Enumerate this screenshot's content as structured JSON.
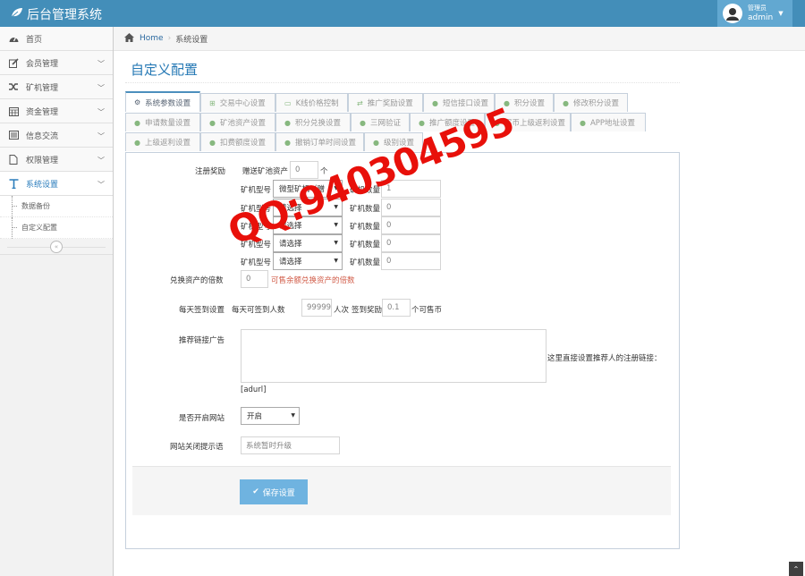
{
  "app": {
    "title": "后台管理系统",
    "user_role": "管理员",
    "user_name": "admin"
  },
  "sidebar": {
    "items": [
      {
        "label": "首页",
        "icon": "dashboard-icon"
      },
      {
        "label": "会员管理",
        "icon": "edit-icon"
      },
      {
        "label": "矿机管理",
        "icon": "shuffle-icon"
      },
      {
        "label": "资金管理",
        "icon": "calendar-icon"
      },
      {
        "label": "信息交流",
        "icon": "list-icon"
      },
      {
        "label": "权限管理",
        "icon": "file-icon"
      },
      {
        "label": "系统设置",
        "icon": "text-icon"
      }
    ],
    "sub_items": [
      {
        "label": "数据备份"
      },
      {
        "label": "自定义配置"
      }
    ],
    "collapse_glyph": "«"
  },
  "breadcrumb": {
    "home": "Home",
    "current": "系统设置"
  },
  "page": {
    "title": "自定义配置"
  },
  "tabs": [
    {
      "label": "系统参数设置"
    },
    {
      "label": "交易中心设置"
    },
    {
      "label": "K线价格控制"
    },
    {
      "label": "推广奖励设置"
    },
    {
      "label": "短信接口设置"
    },
    {
      "label": "积分设置"
    },
    {
      "label": "修改积分设置"
    },
    {
      "label": "申请数量设置"
    },
    {
      "label": "矿池资产设置"
    },
    {
      "label": "积分兑换设置"
    },
    {
      "label": "三网验证"
    },
    {
      "label": "推广额度设置"
    },
    {
      "label": "买币上级返利设置"
    },
    {
      "label": "APP地址设置"
    },
    {
      "label": "上级返利设置"
    },
    {
      "label": "扣费额度设置"
    },
    {
      "label": "撤销订单时间设置"
    },
    {
      "label": "级别设置"
    }
  ],
  "form": {
    "register_reward": {
      "label": "注册奖励",
      "gift_prefix": "赠送矿池资产",
      "gift_value": "0",
      "gift_unit": "个",
      "rows": [
        {
          "type_label": "矿机型号",
          "type_value": "微型矿机（赠",
          "count_label": "矿机数量",
          "count_value": "1"
        },
        {
          "type_label": "矿机型号",
          "type_value": "请选择",
          "count_label": "矿机数量",
          "count_value": "0"
        },
        {
          "type_label": "矿机型号",
          "type_value": "请选择",
          "count_label": "矿机数量",
          "count_value": "0"
        },
        {
          "type_label": "矿机型号",
          "type_value": "请选择",
          "count_label": "矿机数量",
          "count_value": "0"
        },
        {
          "type_label": "矿机型号",
          "type_value": "请选择",
          "count_label": "矿机数量",
          "count_value": "0"
        }
      ]
    },
    "exchange": {
      "label": "兑换资产的倍数",
      "value": "0",
      "hint": "可售余额兑换资产的倍数"
    },
    "checkin": {
      "label": "每天签到设置",
      "prefix": "每天可签到人数",
      "value": "99999",
      "unit": "人次",
      "reward_label": "签到奖励",
      "reward_value": "0.1",
      "reward_unit": "个可售币"
    },
    "ad": {
      "label": "推荐链接广告",
      "side_note": "这里直接设置推荐人的注册链接：",
      "tag": "[adurl]"
    },
    "site_open": {
      "label": "是否开启网站",
      "value": "开启"
    },
    "close_msg": {
      "label": "网站关闭提示语",
      "placeholder": "系统暂时升级"
    },
    "save_label": "保存设置"
  },
  "watermark": "QQ:940304595",
  "colors": {
    "topbar": "#438eb9",
    "accent": "#2679b5",
    "save": "#6fb3e0",
    "watermark": "#e8100a"
  }
}
